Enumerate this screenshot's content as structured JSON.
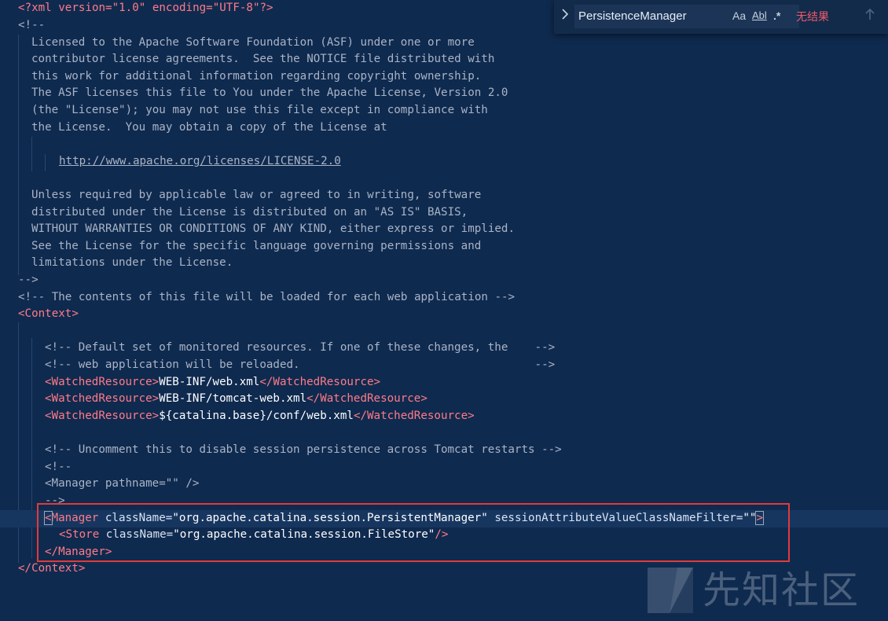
{
  "find": {
    "query": "PersistenceManager",
    "match_case_label": "Aa",
    "whole_word_label": "Abl",
    "regex_label": ".*",
    "result_status": "无结果",
    "prev_icon": "arrow-up-icon",
    "toggle_icon": "chevron-right-icon"
  },
  "code": {
    "l1": {
      "a": "<?xml version=\"1.0\" encoding=\"UTF-8\"?>"
    },
    "l2": {
      "a": "<!--"
    },
    "l3": {
      "a": "Licensed to the Apache Software Foundation (ASF) under one or more"
    },
    "l4": {
      "a": "contributor license agreements.  See the NOTICE file distributed with"
    },
    "l5": {
      "a": "this work for additional information regarding copyright ownership."
    },
    "l6": {
      "a": "The ASF licenses this file to You under the Apache License, Version 2.0"
    },
    "l7": {
      "a": "(the \"License\"); you may not use this file except in compliance with"
    },
    "l8": {
      "a": "the License.  You may obtain a copy of the License at"
    },
    "l10": {
      "a": "http://www.apache.org/licenses/LICENSE-2.0"
    },
    "l12": {
      "a": "Unless required by applicable law or agreed to in writing, software"
    },
    "l13": {
      "a": "distributed under the License is distributed on an \"AS IS\" BASIS,"
    },
    "l14": {
      "a": "WITHOUT WARRANTIES OR CONDITIONS OF ANY KIND, either express or implied."
    },
    "l15": {
      "a": "See the License for the specific language governing permissions and"
    },
    "l16": {
      "a": "limitations under the License."
    },
    "l17": {
      "a": "-->"
    },
    "l18": {
      "a": "<!-- The contents of this file will be loaded for each web application -->"
    },
    "l19": {
      "a": "<Context>"
    },
    "l21": {
      "a": "<!-- Default set of monitored resources. If one of these changes, the    -->"
    },
    "l22": {
      "a": "<!-- web application will be reloaded.                                   -->"
    },
    "l23": {
      "a": "<WatchedResource>",
      "b": "WEB-INF/web.xml",
      "c": "</WatchedResource>"
    },
    "l24": {
      "a": "<WatchedResource>",
      "b": "WEB-INF/tomcat-web.xml",
      "c": "</WatchedResource>"
    },
    "l25": {
      "a": "<WatchedResource>",
      "b": "${catalina.base}/conf/web.xml",
      "c": "</WatchedResource>"
    },
    "l27": {
      "a": "<!-- Uncomment this to disable session persistence across Tomcat restarts -->"
    },
    "l28": {
      "a": "<!--"
    },
    "l29": {
      "a": "<Manager pathname=\"\" />"
    },
    "l30": {
      "a": "-->"
    },
    "l31": {
      "a": "<",
      "b": "Manager",
      "c": " className=",
      "d": "\"org.apache.catalina.session.PersistentManager\"",
      "e": " sessionAttributeValueClassNameFilter=",
      "f": "\"\"",
      "g": ">"
    },
    "l32": {
      "a": "<Store",
      "b": " className=",
      "c": "\"org.apache.catalina.session.FileStore\"",
      "d": "/>"
    },
    "l33": {
      "a": "</Manager>"
    },
    "l34": {
      "a": "</Context>"
    }
  },
  "watermark": {
    "text": "先知社区"
  }
}
